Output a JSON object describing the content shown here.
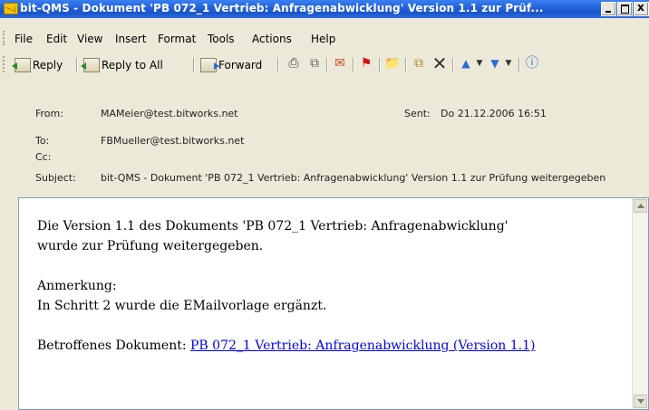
{
  "window": {
    "title": "bit-QMS - Dokument 'PB 072_1 Vertrieb: Anfragenabwicklung' Version 1.1 zur Prüf..."
  },
  "menu": {
    "items": [
      {
        "label": "File"
      },
      {
        "label": "Edit"
      },
      {
        "label": "View"
      },
      {
        "label": "Insert"
      },
      {
        "label": "Format"
      },
      {
        "label": "Tools"
      },
      {
        "label": "Actions"
      },
      {
        "label": "Help"
      }
    ]
  },
  "toolbar": {
    "reply_label": "Reply",
    "reply_all_label": "Reply to All",
    "forward_label": "Forward",
    "icons": [
      "print-icon",
      "copy-icon",
      "message-icon",
      "flag-icon",
      "folder-icon",
      "move-icon",
      "delete-icon",
      "previous-icon",
      "next-icon",
      "help-icon"
    ]
  },
  "header": {
    "from_label": "From:",
    "from_value": "MAMeier@test.bitworks.net",
    "sent_label": "Sent:",
    "sent_value": "Do 21.12.2006 16:51",
    "to_label": "To:",
    "to_value": "FBMueller@test.bitworks.net",
    "cc_label": "Cc:",
    "cc_value": "",
    "subject_label": "Subject:",
    "subject_value": "bit-QMS - Dokument 'PB 072_1 Vertrieb: Anfragenabwicklung' Version 1.1 zur Prüfung weitergegeben"
  },
  "body": {
    "line1": "Die Version 1.1 des Dokuments 'PB 072_1 Vertrieb: Anfragenabwicklung'",
    "line2": "wurde zur Prüfung weitergegeben.",
    "note_label": "Anmerkung:",
    "note_text": "In Schritt 2 wurde die EMailvorlage ergänzt.",
    "doc_prefix": "Betroffenes Dokument: ",
    "doc_link": "PB 072_1 Vertrieb: Anfragenabwicklung (Version 1.1)"
  },
  "colors": {
    "titlebar": "#2463d8",
    "chrome": "#ece9d8",
    "link": "#0000ee"
  }
}
